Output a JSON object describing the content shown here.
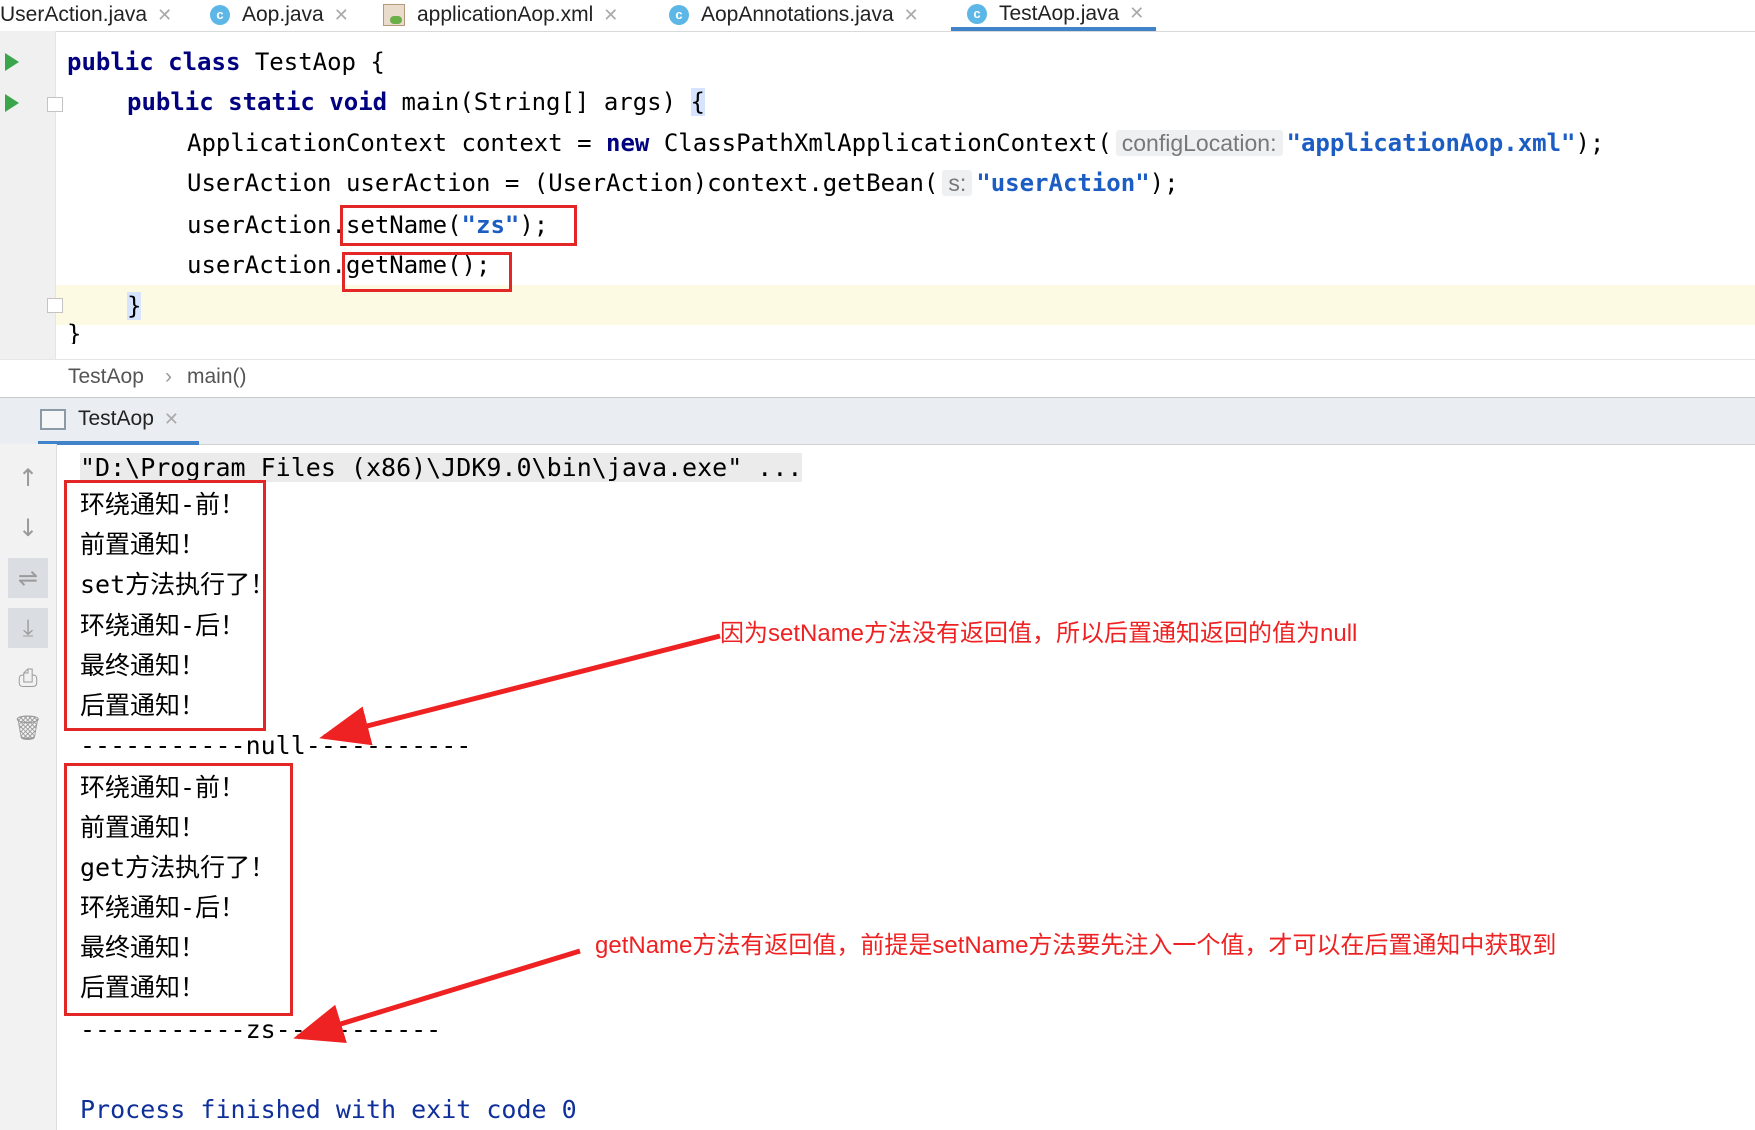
{
  "tabs": [
    {
      "label": "UserAction.java",
      "icon": "none",
      "active": false
    },
    {
      "label": "Aop.java",
      "icon": "class-icon",
      "active": false
    },
    {
      "label": "applicationAop.xml",
      "icon": "xml-icon",
      "active": false
    },
    {
      "label": "AopAnnotations.java",
      "icon": "class-icon",
      "active": false
    },
    {
      "label": "TestAop.java",
      "icon": "class-icon",
      "active": true
    }
  ],
  "editor": {
    "line1": {
      "kw": "public class",
      "rest": " TestAop {"
    },
    "line2": {
      "kw": "public static void",
      "rest": " main(String[] args) ",
      "brace": "{"
    },
    "line3": {
      "pre": "ApplicationContext context = ",
      "kw": "new",
      "mid": " ClassPathXmlApplicationContext(",
      "hint": "configLocation:",
      "str": "\"applicationAop.xml\"",
      "post": ");"
    },
    "line4": {
      "pre": "UserAction userAction = (UserAction)context.getBean(",
      "hint": "s:",
      "str": "\"userAction\"",
      "post": ");"
    },
    "line5": {
      "pre": "userAction",
      "call": ".setName(",
      "str": "\"zs\"",
      "post": ");"
    },
    "line6": {
      "pre": "userAction",
      "call": ".getName();"
    },
    "line7": "}",
    "line8": "}"
  },
  "breadcrumb": {
    "items": [
      "TestAop",
      "main()"
    ],
    "separator": "›"
  },
  "run_panel": {
    "tab_label": "TestAop",
    "command": "\"D:\\Program Files (x86)\\JDK9.0\\bin\\java.exe\" ...",
    "block1": [
      "环绕通知-前！",
      "前置通知！",
      "set方法执行了！",
      "环绕通知-后！",
      "最终通知！",
      "后置通知！"
    ],
    "result1": "-----------null-----------",
    "block2": [
      "环绕通知-前！",
      "前置通知！",
      "get方法执行了！",
      "环绕通知-后！",
      "最终通知！",
      "后置通知！"
    ],
    "result2": "-----------zs-----------",
    "finish": "Process finished with exit code 0"
  },
  "annotations": {
    "note1": "因为setName方法没有返回值，所以后置通知返回的值为null",
    "note2": "getName方法有返回值，前提是setName方法要先注入一个值，才可以在后置通知中获取到"
  },
  "colors": {
    "annotation": "#ee2222",
    "keyword": "#000080",
    "string": "#1c5dc4",
    "tab_underline": "#4083c9",
    "run_icon": "#3aa54a"
  },
  "side_toolbar_icons": [
    "arrow-up-icon",
    "arrow-down-icon",
    "soft-wrap-icon",
    "scroll-to-end-icon",
    "print-icon",
    "trash-icon"
  ]
}
